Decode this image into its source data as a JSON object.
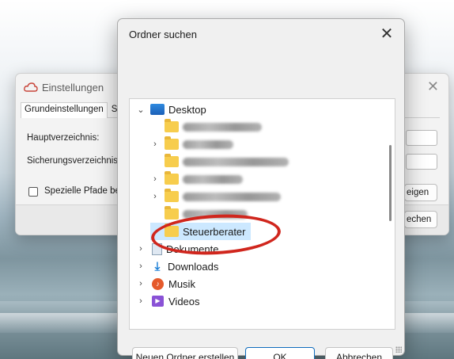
{
  "settings_window": {
    "title": "Einstellungen",
    "tabs": [
      "Grundeinstellungen",
      "S"
    ],
    "labels": {
      "main_dir": "Hauptverzeichnis:",
      "backup_dir": "Sicherungsverzeichnis",
      "special_paths": "Spezielle Pfade be"
    },
    "right_buttons": {
      "show": "eigen",
      "search": "echen"
    },
    "close_glyph": "✕"
  },
  "dialog": {
    "title": "Ordner suchen",
    "close_glyph": "✕",
    "tree": [
      {
        "label": "Desktop",
        "icon": "desktop-icon",
        "expanded": true
      },
      {
        "label": "",
        "icon": "folder-icon",
        "redacted": true
      },
      {
        "label": "",
        "icon": "folder-icon",
        "redacted": true,
        "has_children": true
      },
      {
        "label": "",
        "icon": "folder-icon",
        "redacted": true
      },
      {
        "label": "",
        "icon": "folder-icon",
        "redacted": true,
        "has_children": true
      },
      {
        "label": "",
        "icon": "folder-icon",
        "redacted": true,
        "has_children": true
      },
      {
        "label": "",
        "icon": "folder-icon",
        "redacted": true
      },
      {
        "label": "Steuerberater",
        "icon": "folder-icon",
        "selected": true
      },
      {
        "label": "Dokumente",
        "icon": "documents-icon"
      },
      {
        "label": "Downloads",
        "icon": "downloads-icon"
      },
      {
        "label": "Musik",
        "icon": "music-icon"
      },
      {
        "label": "Videos",
        "icon": "videos-icon"
      }
    ],
    "buttons": {
      "new_folder": "Neuen Ordner erstellen",
      "ok": "OK",
      "cancel": "Abbrechen"
    }
  },
  "annotation": {
    "color": "#d0261d",
    "shape": "ellipse-around-selected"
  }
}
